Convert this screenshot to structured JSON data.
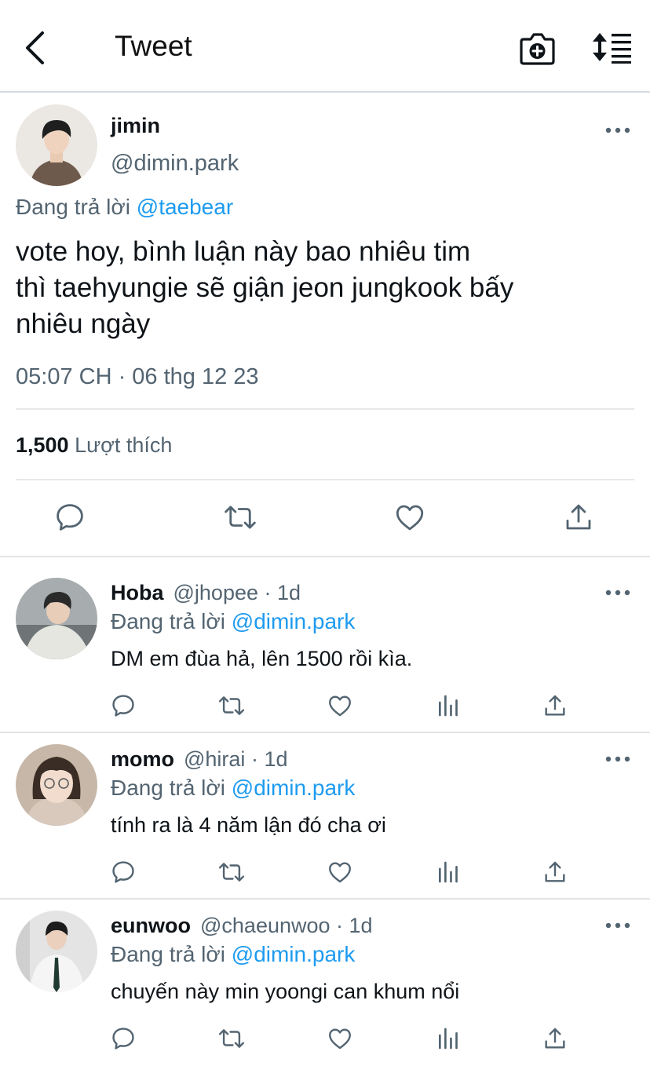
{
  "header": {
    "title": "Tweet",
    "back_icon": "chevron-left-icon",
    "camera_icon": "camera-plus-icon",
    "sort_icon": "sort-list-icon"
  },
  "main_tweet": {
    "name": "jimin",
    "handle": "@dimin.park",
    "reply_prefix": "Đang trả lời",
    "reply_to": "@taebear",
    "text_lines": [
      "vote hoy, bình luận này bao nhiêu tim",
      "thì taehyungie sẽ giận jeon jungkook bấy",
      "nhiêu ngày"
    ],
    "timestamp": "05:07 CH · 06 thg 12 23",
    "likes_count": "1,500",
    "likes_label": "Lượt thích",
    "actions": [
      "reply-icon",
      "retweet-icon",
      "like-icon",
      "share-icon"
    ]
  },
  "replies": [
    {
      "name": "Hoba",
      "handle": "@jhopee",
      "time": "· 1d",
      "reply_prefix": "Đang trả lời",
      "reply_to": "@dimin.park",
      "text": "DM em đùa hả, lên 1500 rồi kìa."
    },
    {
      "name": "momo",
      "handle": "@hirai",
      "time": "· 1d",
      "reply_prefix": "Đang trả lời",
      "reply_to": "@dimin.park",
      "text": "tính ra là 4 năm lận đó cha ơi"
    },
    {
      "name": "eunwoo",
      "handle": "@chaeunwoo",
      "time": "· 1d",
      "reply_prefix": "Đang trả lời",
      "reply_to": "@dimin.park",
      "text": "chuyến này min yoongi can khum nổi"
    }
  ],
  "colors": {
    "link": "#1d9bf0",
    "secondary_text": "#536471",
    "icon": "#536471",
    "divider": "#e6e8ea"
  }
}
